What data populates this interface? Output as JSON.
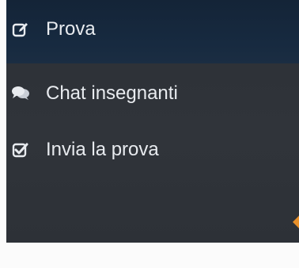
{
  "sidebar": {
    "items": [
      {
        "label": "Prova",
        "icon": "edit-icon"
      },
      {
        "label": "Chat insegnanti",
        "icon": "chat-bubbles-icon"
      },
      {
        "label": "Invia la prova",
        "icon": "checkbox-icon"
      }
    ]
  },
  "colors": {
    "header": "#172a40",
    "sidebar_bg": "#2f3339",
    "text": "#e8ebef",
    "accent": "#e8902a"
  }
}
